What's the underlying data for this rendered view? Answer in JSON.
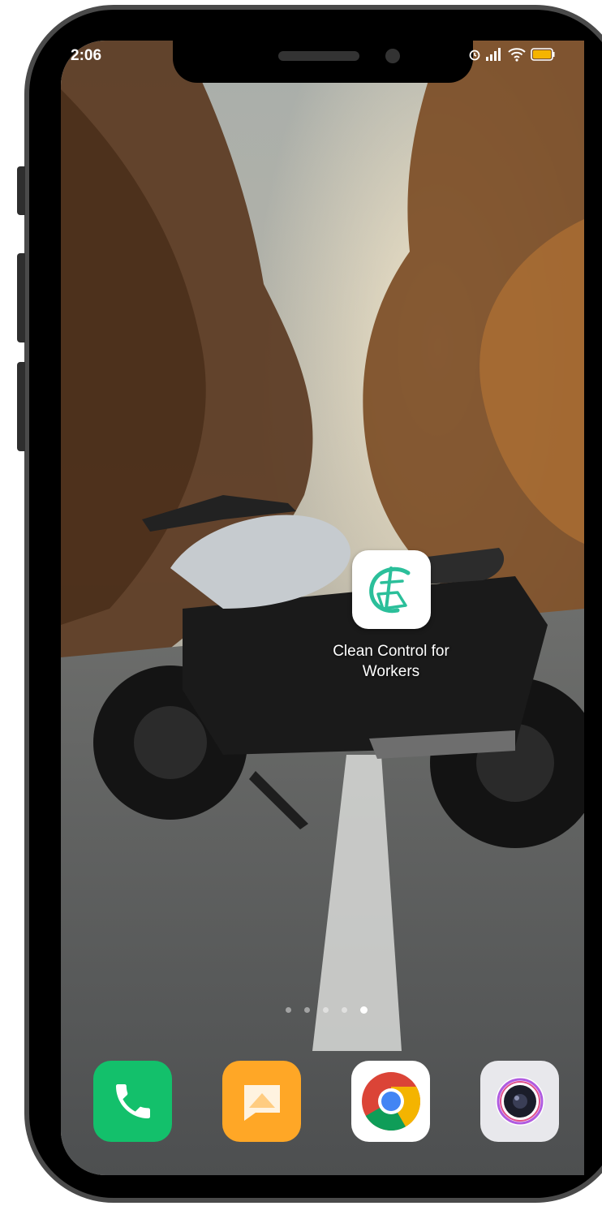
{
  "status_bar": {
    "time": "2:06",
    "icons": [
      "alarm-icon",
      "signal-icon",
      "wifi-icon",
      "battery-icon"
    ],
    "battery_color": "#f5b400"
  },
  "home": {
    "app": {
      "label": "Clean Control for Workers",
      "icon": "clean-control-logo-icon",
      "accent": "#2bbf9a"
    },
    "page_indicator": {
      "count": 5,
      "active_index": 4
    }
  },
  "dock": [
    {
      "name": "phone",
      "icon": "phone-icon",
      "color": "#13c06b"
    },
    {
      "name": "messages",
      "icon": "message-icon",
      "color": "#ffa726"
    },
    {
      "name": "chrome",
      "icon": "chrome-icon",
      "color": "#ffffff"
    },
    {
      "name": "camera",
      "icon": "camera-icon",
      "color": "#e8e8ec"
    }
  ]
}
